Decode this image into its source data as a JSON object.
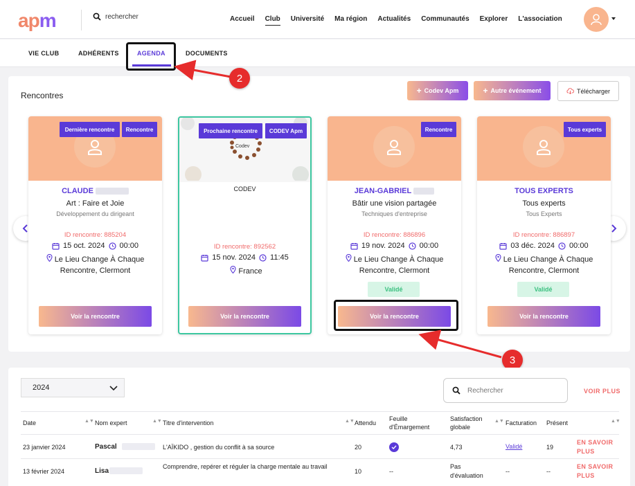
{
  "header": {
    "logo_main": "ap",
    "logo_accent": "m",
    "search_placeholder": "rechercher",
    "nav": [
      "Accueil",
      "Club",
      "Université",
      "Ma région",
      "Actualités",
      "Communautés",
      "Explorer",
      "L'association"
    ],
    "nav_active": "Club"
  },
  "subtabs": [
    "VIE CLUB",
    "ADHÉRENTS",
    "AGENDA",
    "DOCUMENTS"
  ],
  "subtab_active": "AGENDA",
  "rencontres": {
    "title": "Rencontres",
    "btn_codev": "Codev Apm",
    "btn_autre": "Autre événement",
    "btn_telecharger": "Télécharger",
    "cards": [
      {
        "tags": [
          "Dernière rencontre",
          "Rencontre"
        ],
        "name": "CLAUDE",
        "title": "Art : Faire et Joie",
        "subtitle": "Développement du dirigeant",
        "id": "ID rencontre: 885204",
        "date": "15 oct. 2024",
        "time": "00:00",
        "location": "Le Lieu Change À Chaque Rencontre, Clermont",
        "status": "",
        "button": "Voir la rencontre"
      },
      {
        "tags": [
          "Prochaine rencontre",
          "CODEV Apm"
        ],
        "name": "",
        "title": "CODEV",
        "subtitle": "",
        "image_text": "Codev",
        "id": "ID rencontre: 892562",
        "date": "15 nov. 2024",
        "time": "11:45",
        "location": "France",
        "status": "",
        "button": "Voir la rencontre"
      },
      {
        "tags": [
          "Rencontre"
        ],
        "name": "JEAN-GABRIEL",
        "title": "Bâtir une vision partagée",
        "subtitle": "Techniques d'entreprise",
        "id": "ID rencontre: 886896",
        "date": "19 nov. 2024",
        "time": "00:00",
        "location": "Le Lieu Change À Chaque Rencontre, Clermont",
        "status": "Validé",
        "button": "Voir la rencontre"
      },
      {
        "tags": [
          "Tous experts"
        ],
        "name": "TOUS EXPERTS",
        "title": "Tous experts",
        "subtitle": "Tous Experts",
        "id": "ID rencontre: 886897",
        "date": "03 déc. 2024",
        "time": "00:00",
        "location": "Le Lieu Change À Chaque Rencontre, Clermont",
        "status": "Validé",
        "button": "Voir la rencontre"
      }
    ]
  },
  "annotations": [
    "2",
    "3"
  ],
  "table": {
    "year": "2024",
    "search_placeholder": "Rechercher",
    "voir_plus": "VOIR PLUS",
    "headers": [
      "Date",
      "Nom expert",
      "Titre d'intervention",
      "Attendu",
      "Feuille d'Émargement",
      "Satisfaction globale",
      "Facturation",
      "Présent"
    ],
    "rows": [
      {
        "date": "23 janvier 2024",
        "expert": "Pascal",
        "title": "L'AÏKIDO , gestion du conflit à sa source",
        "attendu": "20",
        "emargement": "check",
        "satisfaction": "4,73",
        "facturation": "Validé",
        "present": "19",
        "action": "EN SAVOIR PLUS"
      },
      {
        "date": "13 février 2024",
        "expert": "Lisa",
        "title": "Comprendre, repérer et réguler la charge mentale au travail",
        "attendu": "10",
        "emargement": "--",
        "satisfaction": "Pas d'évaluation",
        "facturation": "--",
        "present": "--",
        "action": "EN SAVOIR PLUS"
      }
    ]
  },
  "colors": {
    "accent": "#5a3ad8",
    "peach": "#f9b58e",
    "red": "#f06a6a",
    "green": "#3cc7a0"
  }
}
